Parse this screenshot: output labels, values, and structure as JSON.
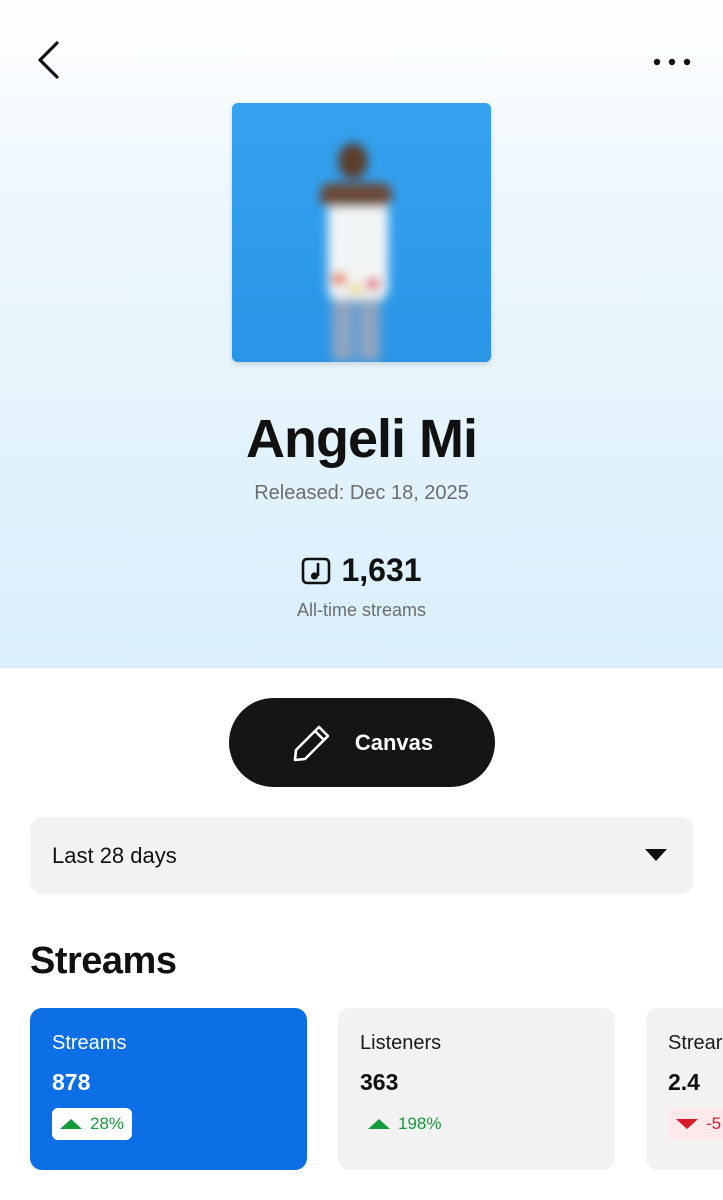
{
  "header": {
    "back_icon": "chevron-left-icon",
    "more_icon": "more-horizontal-icon"
  },
  "release": {
    "title": "Angeli Mi",
    "released": "Released: Dec 18, 2025",
    "all_time_streams": "1,631",
    "all_time_streams_label": "All-time streams",
    "stream_icon": "music-note-icon"
  },
  "actions": {
    "canvas_label": "Canvas",
    "canvas_icon": "pencil-icon"
  },
  "range": {
    "selected": "Last 28 days",
    "dropdown_icon": "caret-down-icon"
  },
  "stats": {
    "section_title": "Streams",
    "cards": [
      {
        "label": "Streams",
        "value": "878",
        "delta": "28%",
        "direction": "up"
      },
      {
        "label": "Listeners",
        "value": "363",
        "delta": "198%",
        "direction": "up"
      },
      {
        "label": "Strear",
        "value": "2.4",
        "delta": "-5",
        "direction": "down"
      }
    ]
  },
  "colors": {
    "accent": "#0c6fe6",
    "positive": "#159a3c",
    "negative": "#d91a2a",
    "button_dark": "#151515"
  }
}
